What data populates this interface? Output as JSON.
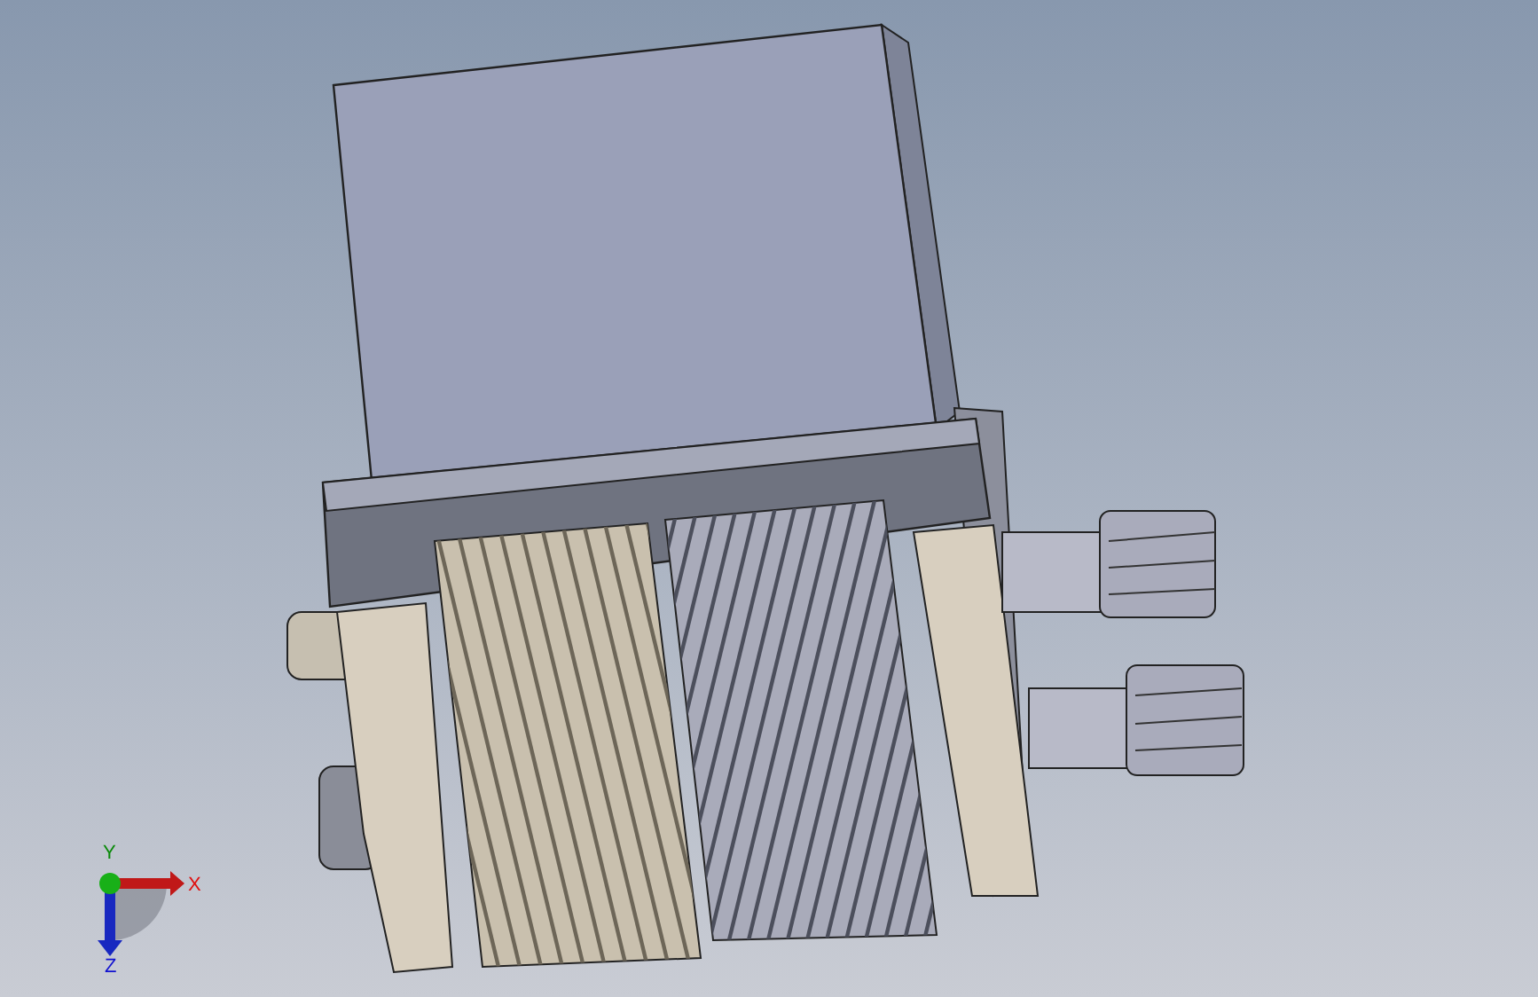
{
  "triad": {
    "axes": [
      {
        "label": "X"
      },
      {
        "label": "Y"
      },
      {
        "label": "Z"
      }
    ]
  }
}
